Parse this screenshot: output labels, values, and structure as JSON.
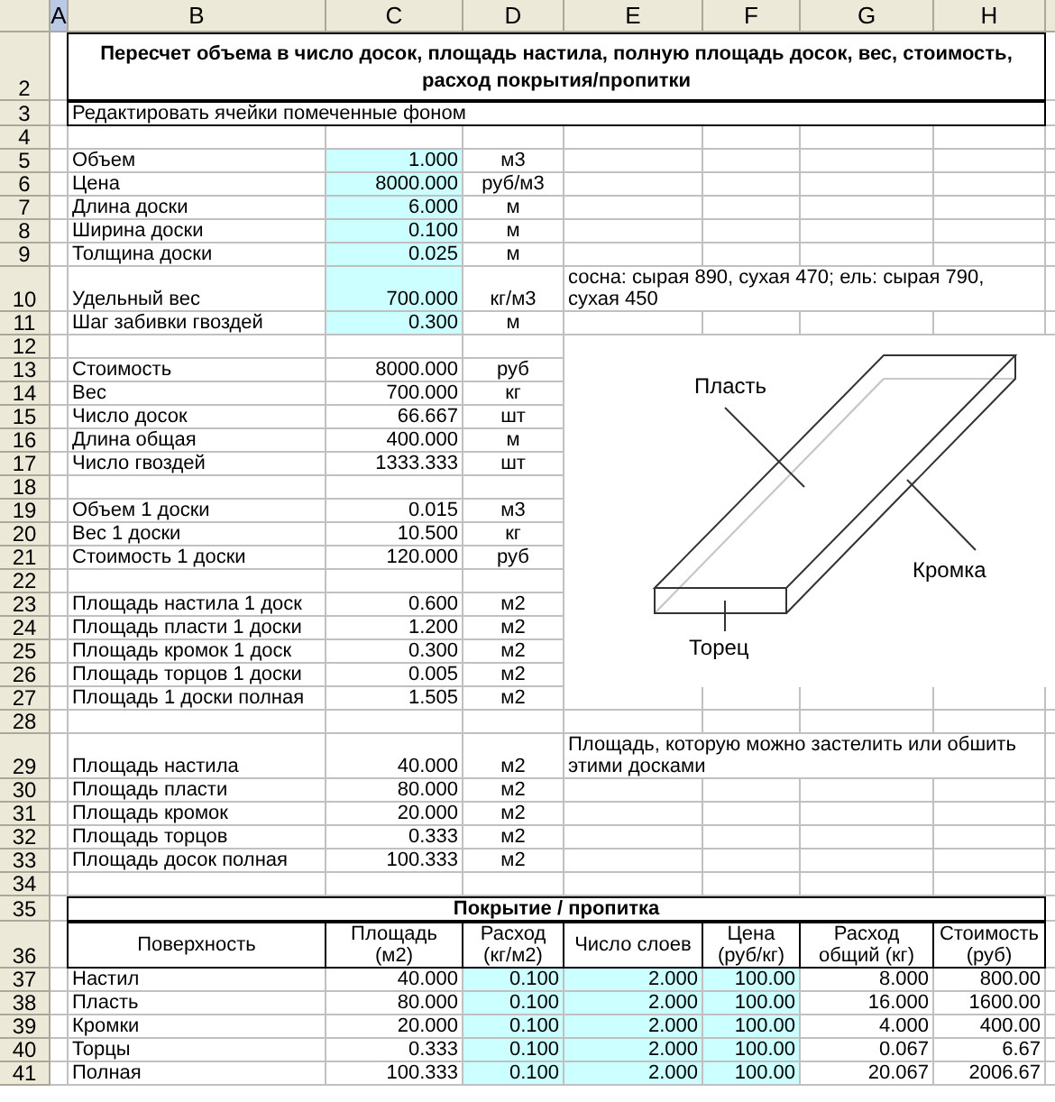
{
  "columns": [
    {
      "label": "A",
      "selected": true
    },
    {
      "label": "B",
      "selected": false
    },
    {
      "label": "C",
      "selected": false
    },
    {
      "label": "D",
      "selected": false
    },
    {
      "label": "E",
      "selected": false
    },
    {
      "label": "F",
      "selected": false
    },
    {
      "label": "G",
      "selected": false
    },
    {
      "label": "H",
      "selected": false
    }
  ],
  "rows": [
    {
      "number": "2",
      "kind": "title",
      "text": "Пересчет объема в число досок, площадь настила, полную площадь досок, вес, стоимость, расход покрытия/пропитки"
    },
    {
      "number": "3",
      "kind": "note",
      "text": "Редактировать ячейки помеченные фоном"
    },
    {
      "number": "4",
      "kind": "blank"
    },
    {
      "number": "5",
      "kind": "param",
      "label": "Объем",
      "value": "1.000",
      "unit": "м3",
      "editable": true
    },
    {
      "number": "6",
      "kind": "param",
      "label": "Цена",
      "value": "8000.000",
      "unit": "руб/м3",
      "editable": true
    },
    {
      "number": "7",
      "kind": "param",
      "label": "Длина доски",
      "value": "6.000",
      "unit": "м",
      "editable": true
    },
    {
      "number": "8",
      "kind": "param",
      "label": "Ширина доски",
      "value": "0.100",
      "unit": "м",
      "editable": true
    },
    {
      "number": "9",
      "kind": "param",
      "label": "Толщина доски",
      "value": "0.025",
      "unit": "м",
      "editable": true
    },
    {
      "number": "10",
      "kind": "param",
      "label": "Удельный вес",
      "value": "700.000",
      "unit": "кг/м3",
      "editable": true,
      "comment": "сосна: сырая 890, сухая 470; ель: сырая 790, сухая 450"
    },
    {
      "number": "11",
      "kind": "param",
      "label": "Шаг забивки гвоздей",
      "value": "0.300",
      "unit": "м",
      "editable": true
    },
    {
      "number": "12",
      "kind": "blank"
    },
    {
      "number": "13",
      "kind": "param",
      "label": "Стоимость",
      "value": "8000.000",
      "unit": "руб",
      "editable": false
    },
    {
      "number": "14",
      "kind": "param",
      "label": "Вес",
      "value": "700.000",
      "unit": "кг",
      "editable": false
    },
    {
      "number": "15",
      "kind": "param",
      "label": "Число досок",
      "value": "66.667",
      "unit": "шт",
      "editable": false
    },
    {
      "number": "16",
      "kind": "param",
      "label": "Длина общая",
      "value": "400.000",
      "unit": "м",
      "editable": false
    },
    {
      "number": "17",
      "kind": "param",
      "label": "Число гвоздей",
      "value": "1333.333",
      "unit": "шт",
      "editable": false
    },
    {
      "number": "18",
      "kind": "blank"
    },
    {
      "number": "19",
      "kind": "param",
      "label": "Объем 1 доски",
      "value": "0.015",
      "unit": "м3",
      "editable": false
    },
    {
      "number": "20",
      "kind": "param",
      "label": "Вес 1 доски",
      "value": "10.500",
      "unit": "кг",
      "editable": false
    },
    {
      "number": "21",
      "kind": "param",
      "label": "Стоимость 1 доски",
      "value": "120.000",
      "unit": "руб",
      "editable": false
    },
    {
      "number": "22",
      "kind": "blank"
    },
    {
      "number": "23",
      "kind": "param",
      "label": "Площадь настила 1 доск",
      "value": "0.600",
      "unit": "м2",
      "editable": false
    },
    {
      "number": "24",
      "kind": "param",
      "label": "Площадь пласти 1 доски",
      "value": "1.200",
      "unit": "м2",
      "editable": false
    },
    {
      "number": "25",
      "kind": "param",
      "label": "Площадь кромок 1 доск",
      "value": "0.300",
      "unit": "м2",
      "editable": false
    },
    {
      "number": "26",
      "kind": "param",
      "label": "Площадь торцов 1 доски",
      "value": "0.005",
      "unit": "м2",
      "editable": false
    },
    {
      "number": "27",
      "kind": "param",
      "label": "Площадь 1 доски полная",
      "value": "1.505",
      "unit": "м2",
      "editable": false
    },
    {
      "number": "28",
      "kind": "blank"
    },
    {
      "number": "29",
      "kind": "param",
      "label": "Площадь настила",
      "value": "40.000",
      "unit": "м2",
      "editable": false,
      "comment": "Площадь, которую можно застелить или обшить этими досками"
    },
    {
      "number": "30",
      "kind": "param",
      "label": "Площадь пласти",
      "value": "80.000",
      "unit": "м2",
      "editable": false
    },
    {
      "number": "31",
      "kind": "param",
      "label": "Площадь кромок",
      "value": "20.000",
      "unit": "м2",
      "editable": false
    },
    {
      "number": "32",
      "kind": "param",
      "label": "Площадь торцов",
      "value": "0.333",
      "unit": "м2",
      "editable": false
    },
    {
      "number": "33",
      "kind": "param",
      "label": "Площадь досок полная",
      "value": "100.333",
      "unit": "м2",
      "editable": false
    },
    {
      "number": "34",
      "kind": "blank"
    },
    {
      "number": "35",
      "kind": "table_title",
      "text": "Покрытие / пропитка"
    },
    {
      "number": "36",
      "kind": "table_header",
      "cells": [
        "Поверхность",
        "Площадь (м2)",
        "Расход (кг/м2)",
        "Число слоев",
        "Цена (руб/кг)",
        "Расход общий (кг)",
        "Стоимость (руб)"
      ]
    },
    {
      "number": "37",
      "kind": "table_row",
      "cells": [
        {
          "text": "Настил",
          "editable": false
        },
        {
          "text": "40.000",
          "editable": false
        },
        {
          "text": "0.100",
          "editable": true
        },
        {
          "text": "2.000",
          "editable": true
        },
        {
          "text": "100.00",
          "editable": true
        },
        {
          "text": "8.000",
          "editable": false
        },
        {
          "text": "800.00",
          "editable": false
        }
      ]
    },
    {
      "number": "38",
      "kind": "table_row",
      "cells": [
        {
          "text": "Пласть",
          "editable": false
        },
        {
          "text": "80.000",
          "editable": false
        },
        {
          "text": "0.100",
          "editable": true
        },
        {
          "text": "2.000",
          "editable": true
        },
        {
          "text": "100.00",
          "editable": true
        },
        {
          "text": "16.000",
          "editable": false
        },
        {
          "text": "1600.00",
          "editable": false
        }
      ]
    },
    {
      "number": "39",
      "kind": "table_row",
      "cells": [
        {
          "text": "Кромки",
          "editable": false
        },
        {
          "text": "20.000",
          "editable": false
        },
        {
          "text": "0.100",
          "editable": true
        },
        {
          "text": "2.000",
          "editable": true
        },
        {
          "text": "100.00",
          "editable": true
        },
        {
          "text": "4.000",
          "editable": false
        },
        {
          "text": "400.00",
          "editable": false
        }
      ]
    },
    {
      "number": "40",
      "kind": "table_row",
      "cells": [
        {
          "text": "Торцы",
          "editable": false
        },
        {
          "text": "0.333",
          "editable": false
        },
        {
          "text": "0.100",
          "editable": true
        },
        {
          "text": "2.000",
          "editable": true
        },
        {
          "text": "100.00",
          "editable": true
        },
        {
          "text": "0.067",
          "editable": false
        },
        {
          "text": "6.67",
          "editable": false
        }
      ]
    },
    {
      "number": "41",
      "kind": "table_row",
      "cells": [
        {
          "text": "Полная",
          "editable": false
        },
        {
          "text": "100.333",
          "editable": false
        },
        {
          "text": "0.100",
          "editable": true
        },
        {
          "text": "2.000",
          "editable": true
        },
        {
          "text": "100.00",
          "editable": true
        },
        {
          "text": "20.067",
          "editable": false
        },
        {
          "text": "2006.67",
          "editable": false
        }
      ]
    }
  ],
  "drawing": {
    "face_label": "Пласть",
    "edge_label": "Кромка",
    "end_label": "Торец"
  }
}
